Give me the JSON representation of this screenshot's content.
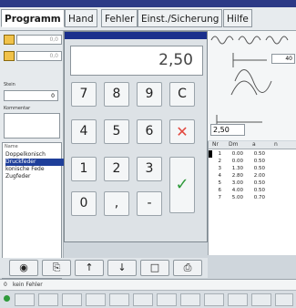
{
  "menu": {
    "tabs": [
      "Programm",
      "Hand",
      "Fehler",
      "Einst./Sicherung",
      "Hilfe"
    ]
  },
  "left": {
    "field1": "0,0",
    "field2": "0,0",
    "step_label": "Stein",
    "step_value": "0",
    "comment_label": "Kommentar",
    "list_header": "Name",
    "list_items": [
      "Doppelkonisch",
      "Druckfeder",
      "konische Fede",
      "Zugfeder"
    ],
    "selected_index": 1
  },
  "keypad": {
    "display": "2,50",
    "keys": {
      "k7": "7",
      "k8": "8",
      "k9": "9",
      "clear": "C",
      "k4": "4",
      "k5": "5",
      "k6": "6",
      "cancel": "✕",
      "k1": "1",
      "k2": "2",
      "k3": "3",
      "ok": "✓",
      "k0": "0",
      "comma": ",",
      "minus": "-"
    }
  },
  "diagram": {
    "field_value": "2,50",
    "top_value": "40"
  },
  "table": {
    "headers": [
      "Nr",
      "Dm",
      "a",
      "n"
    ],
    "rows": [
      [
        "1",
        "0.00",
        "0.50"
      ],
      [
        "2",
        "0.00",
        "0.50"
      ],
      [
        "3",
        "1.30",
        "0.50"
      ],
      [
        "4",
        "2.80",
        "2.00"
      ],
      [
        "5",
        "3.00",
        "0.50"
      ],
      [
        "6",
        "4.00",
        "0.50"
      ],
      [
        "7",
        "5.00",
        "0.70"
      ]
    ]
  },
  "toolbar": {
    "buttons": [
      "binoculars-icon",
      "bracket-icon",
      "up-arrow-icon",
      "down-arrow-icon",
      "page-icon",
      "print-icon"
    ]
  },
  "status": {
    "count": "0",
    "text": "kein Fehler"
  },
  "colors": {
    "title_blue": "#1a2f8c",
    "cancel_red": "#e2483e",
    "ok_green": "#2f9a3b",
    "selection": "#1f3f9a"
  }
}
